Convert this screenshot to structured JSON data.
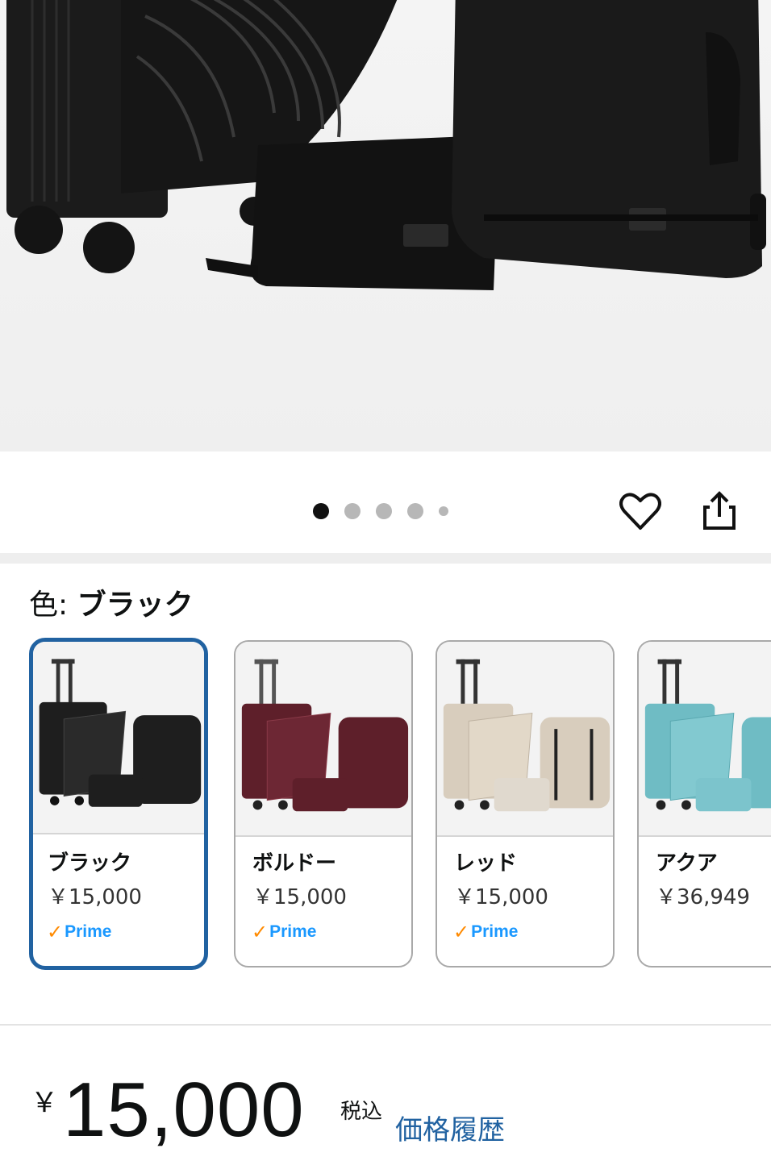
{
  "carousel": {
    "image_icon": "luggage-set-photo",
    "dot_count": 5,
    "active_index": 0
  },
  "actions": {
    "favorite_icon": "heart-icon",
    "share_icon": "share-icon"
  },
  "color_selector": {
    "label": "色: ",
    "selected_value": "ブラック",
    "options": [
      {
        "name": "ブラック",
        "price": "￥15,000",
        "prime": "Prime",
        "color": "#1e1e1e",
        "selected": true
      },
      {
        "name": "ボルドー",
        "price": "￥15,000",
        "prime": "Prime",
        "color": "#5e1f2a",
        "selected": false
      },
      {
        "name": "レッド",
        "price": "￥15,000",
        "prime": "Prime",
        "color": "#ddd2c2",
        "selected": false
      },
      {
        "name": "アクア",
        "price": "￥36,949",
        "prime": "",
        "color": "#7cc4cc",
        "selected": false
      }
    ]
  },
  "price": {
    "currency": "￥",
    "amount": "15,000",
    "tax_label": "税込",
    "history_link": "価格履歴"
  },
  "colors": {
    "accent": "#2162a1",
    "prime_check": "#ff8a00",
    "prime_text": "#1a98ff"
  }
}
